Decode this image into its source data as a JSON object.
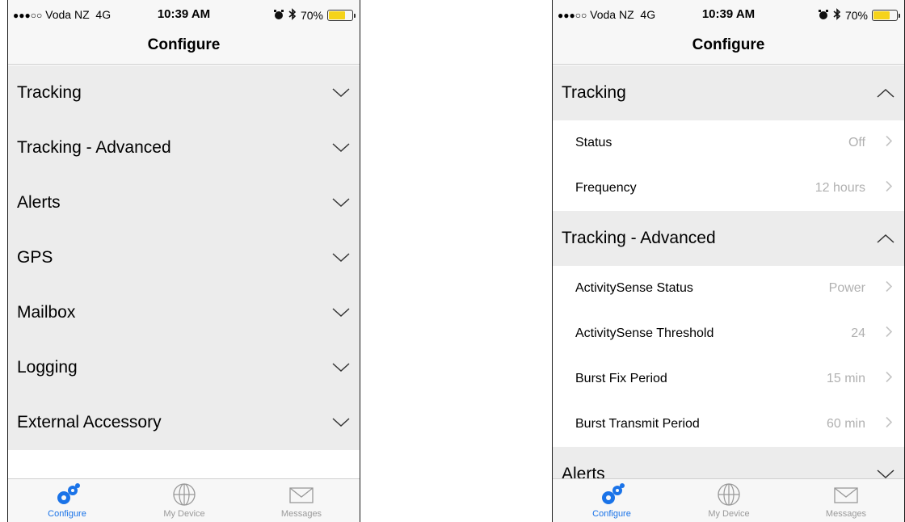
{
  "status_bar": {
    "signal_dots": "●●●○○",
    "carrier": "Voda NZ",
    "network": "4G",
    "time": "10:39 AM",
    "battery": "70%",
    "battery_level": 0.7
  },
  "nav": {
    "title": "Configure"
  },
  "left": {
    "sections": [
      {
        "label": "Tracking"
      },
      {
        "label": "Tracking - Advanced"
      },
      {
        "label": "Alerts"
      },
      {
        "label": "GPS"
      },
      {
        "label": "Mailbox"
      },
      {
        "label": "Logging"
      },
      {
        "label": "External Accessory"
      }
    ]
  },
  "right": {
    "tracking": {
      "label": "Tracking",
      "rows": [
        {
          "label": "Status",
          "value": "Off"
        },
        {
          "label": "Frequency",
          "value": "12 hours"
        }
      ]
    },
    "advanced": {
      "label": "Tracking - Advanced",
      "rows": [
        {
          "label": "ActivitySense Status",
          "value": "Power"
        },
        {
          "label": "ActivitySense Threshold",
          "value": "24"
        },
        {
          "label": "Burst Fix Period",
          "value": "15 min"
        },
        {
          "label": "Burst Transmit Period",
          "value": "60 min"
        }
      ]
    },
    "alerts": {
      "label": "Alerts"
    }
  },
  "tabs": [
    {
      "label": "Configure",
      "icon": "gears-icon",
      "active": true
    },
    {
      "label": "My Device",
      "icon": "globe-icon",
      "active": false
    },
    {
      "label": "Messages",
      "icon": "envelope-icon",
      "active": false
    }
  ],
  "colors": {
    "accent": "#1a73e8",
    "section_bg": "#ececec",
    "value_text": "#b0b0b0",
    "battery": "#f5d31a"
  }
}
